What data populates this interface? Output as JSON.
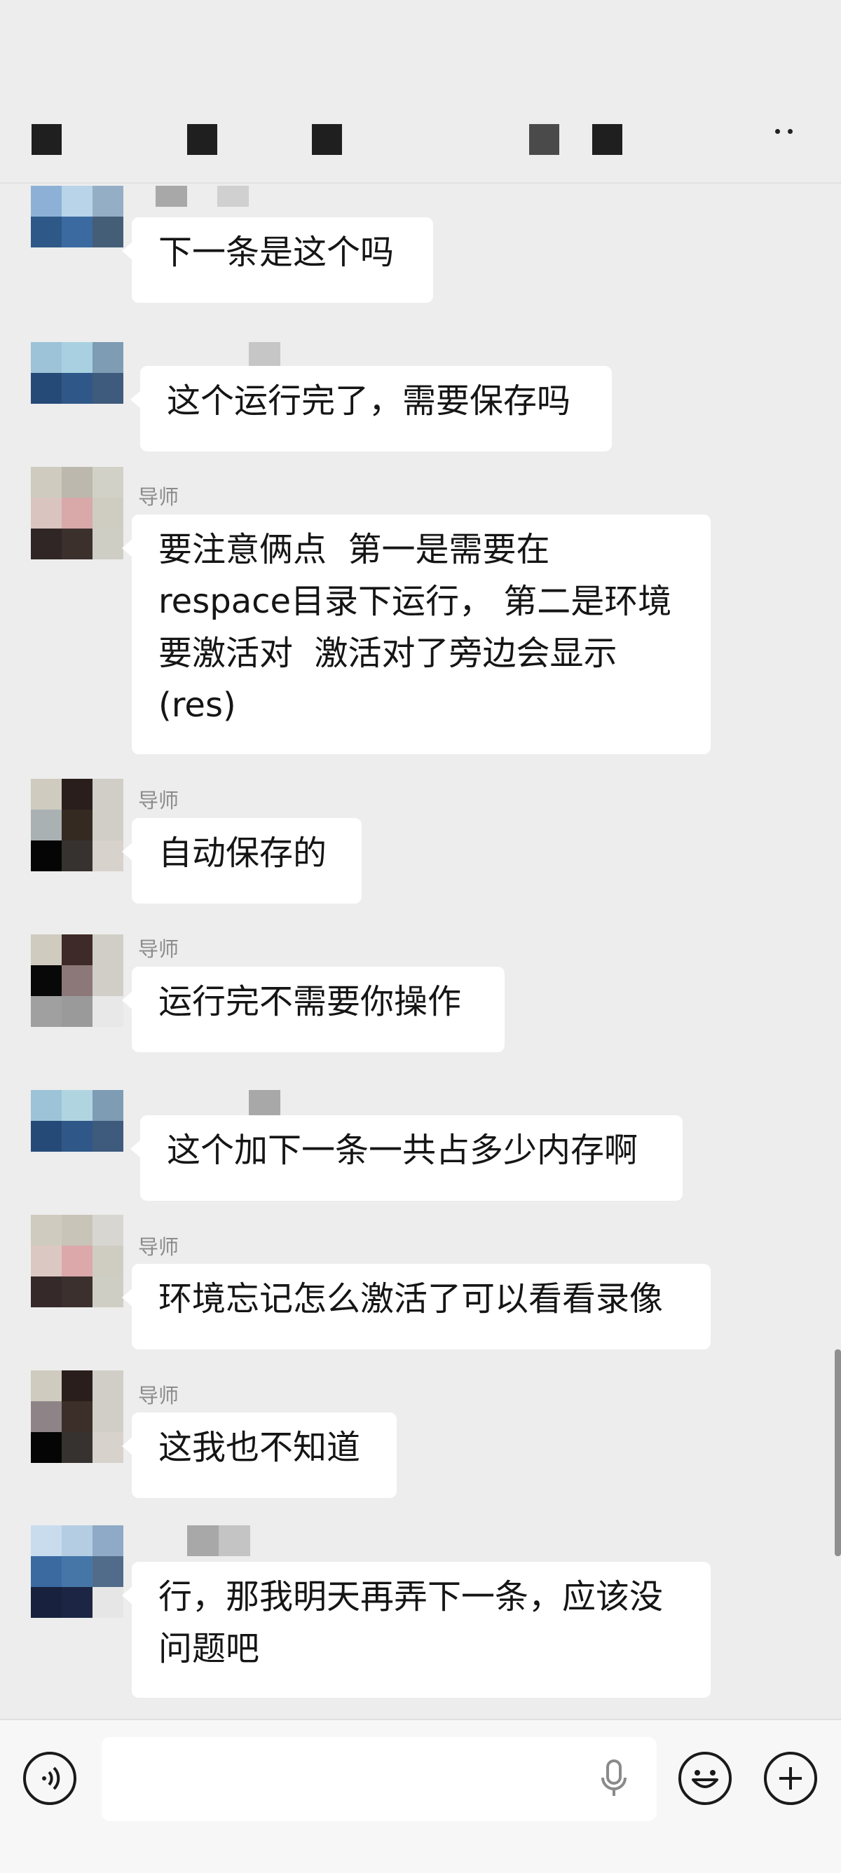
{
  "header": {
    "title_obscured": true,
    "more_icon": "more-dots-icon"
  },
  "messages": [
    {
      "sender": "",
      "text": "下一条是这个吗"
    },
    {
      "sender": "",
      "text": "这个运行完了，需要保存吗"
    },
    {
      "sender": "导师",
      "text": "要注意俩点  第一是需要在\nrespace目录下运行， 第二是环境\n要激活对  激活对了旁边会显示\n(res)"
    },
    {
      "sender": "导师",
      "text": "自动保存的"
    },
    {
      "sender": "导师",
      "text": "运行完不需要你操作"
    },
    {
      "sender": "",
      "text": "这个加下一条一共占多少内存啊"
    },
    {
      "sender": "导师",
      "text": "环境忘记怎么激活了可以看看录像"
    },
    {
      "sender": "导师",
      "text": "这我也不知道"
    },
    {
      "sender": "",
      "text": "行，那我明天再弄下一条，应该没\n问题吧"
    }
  ],
  "input_bar": {
    "voice_icon": "voice-mode-icon",
    "mic_icon": "microphone-icon",
    "emoji_icon": "emoji-icon",
    "plus_icon": "plus-icon"
  }
}
